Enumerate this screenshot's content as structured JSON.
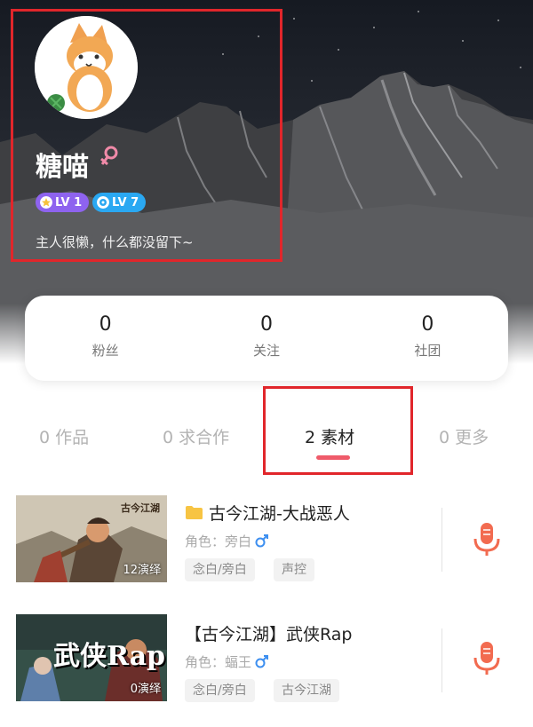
{
  "profile": {
    "username": "糖喵",
    "badges": [
      {
        "label": "LV 1",
        "icon": "star-icon"
      },
      {
        "label": "LV 7",
        "icon": "disc-icon"
      }
    ],
    "bio": "主人很懒，什么都没留下~"
  },
  "stats": [
    {
      "value": "0",
      "label": "粉丝"
    },
    {
      "value": "0",
      "label": "关注"
    },
    {
      "value": "0",
      "label": "社团"
    }
  ],
  "tabs": [
    {
      "label": "0 作品",
      "active": false
    },
    {
      "label": "0 求合作",
      "active": false
    },
    {
      "label": "2 素材",
      "active": true
    },
    {
      "label": "0 更多",
      "active": false
    }
  ],
  "items": [
    {
      "thumb_count": "12演绎",
      "thumb_caption": "古今江湖",
      "title": "古今江湖-大战恶人",
      "role": "角色：旁白",
      "tags": [
        "念白/旁白",
        "声控"
      ]
    },
    {
      "thumb_count": "0演绎",
      "thumb_caption": "武侠Rap",
      "title": "【古今江湖】武侠Rap",
      "role": "角色：蝠王",
      "tags": [
        "念白/旁白",
        "古今江湖"
      ]
    }
  ],
  "colors": {
    "accent": "#ef5b6a",
    "mic": "#f26b50",
    "highlight_box": "#e1262b",
    "badge_lv1": "#8e63ef",
    "badge_lv7": "#2aa8f2",
    "male": "#3d8ff0",
    "female": "#f08aa8"
  }
}
